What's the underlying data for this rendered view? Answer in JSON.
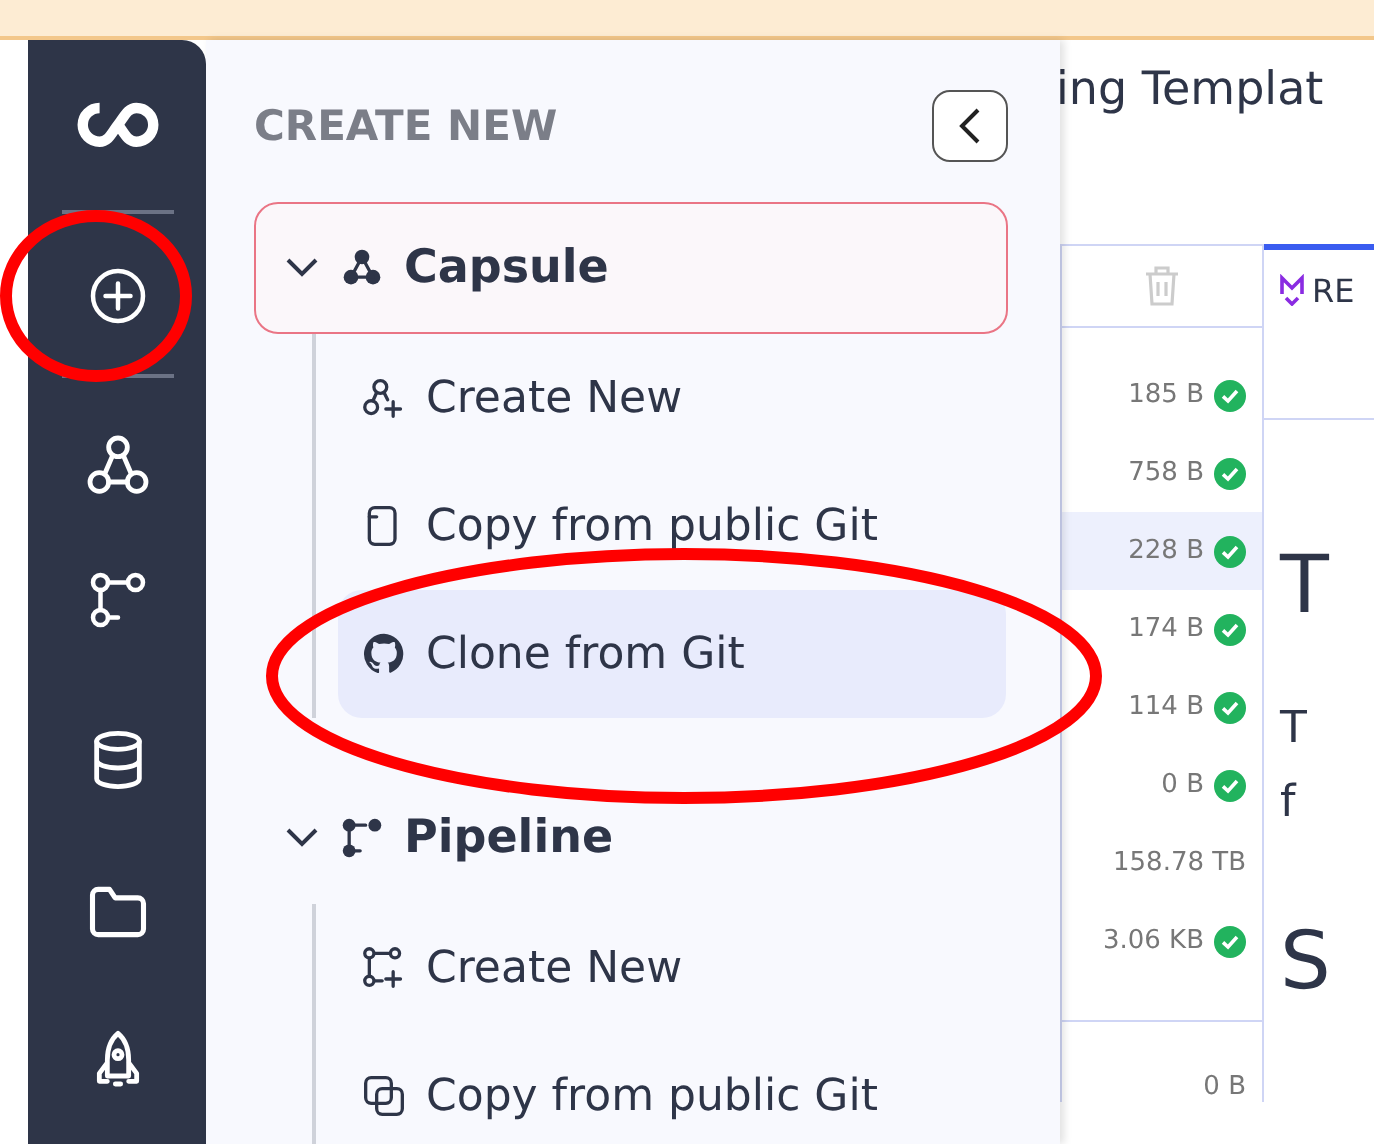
{
  "panel": {
    "heading": "CREATE NEW",
    "groups": [
      {
        "label": "Capsule",
        "kind": "capsule",
        "expanded": true,
        "selected": true,
        "items": [
          {
            "label": "Create New",
            "kind": "create-capsule",
            "selected": false
          },
          {
            "label": "Copy from public Git",
            "kind": "copy",
            "selected": false
          },
          {
            "label": "Clone from Git",
            "kind": "github",
            "selected": true
          }
        ]
      },
      {
        "label": "Pipeline",
        "kind": "pipeline",
        "expanded": true,
        "selected": false,
        "items": [
          {
            "label": "Create New",
            "kind": "create-pipeline",
            "selected": false
          },
          {
            "label": "Copy from public Git",
            "kind": "copy-stack",
            "selected": false
          }
        ]
      }
    ]
  },
  "background": {
    "title": "ing Templat",
    "tab": "RE",
    "files": [
      {
        "size": "185 B",
        "done": true,
        "selected": false
      },
      {
        "size": "758 B",
        "done": true,
        "selected": false
      },
      {
        "size": "228 B",
        "done": true,
        "selected": true
      },
      {
        "size": "174 B",
        "done": true,
        "selected": false
      },
      {
        "size": "114 B",
        "done": true,
        "selected": false
      },
      {
        "size": "0 B",
        "done": true,
        "selected": false
      },
      {
        "size": "158.78 TB",
        "done": false,
        "selected": false
      },
      {
        "size": "3.06 KB",
        "done": true,
        "selected": false
      }
    ],
    "extra_size": "0 B",
    "fragments": [
      "T",
      "T",
      "f",
      "S"
    ]
  }
}
